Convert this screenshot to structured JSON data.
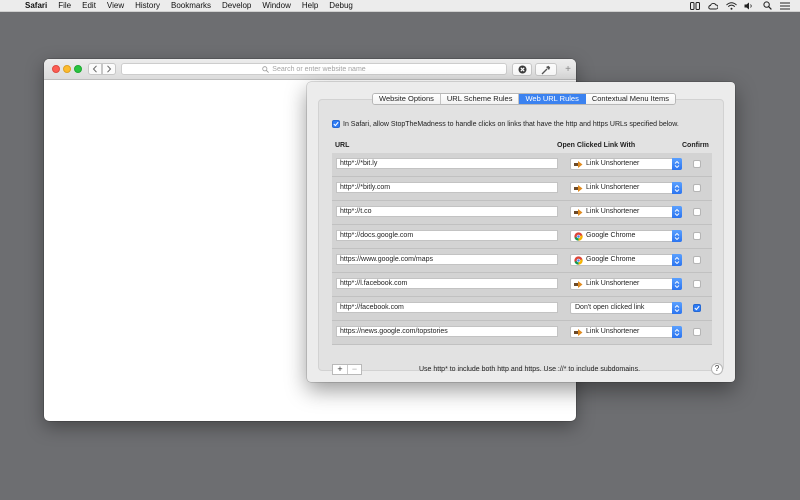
{
  "menubar": {
    "app_name": "Safari",
    "items": [
      "File",
      "Edit",
      "View",
      "History",
      "Bookmarks",
      "Develop",
      "Window",
      "Help",
      "Debug"
    ]
  },
  "safari": {
    "address_placeholder": "Search or enter website name"
  },
  "prefs": {
    "tabs": [
      "Website Options",
      "URL Scheme Rules",
      "Web URL Rules",
      "Contextual Menu Items"
    ],
    "active_tab": "Web URL Rules",
    "allow_text": "In Safari, allow StopTheMadness to handle clicks on links that have the http and https URLs specified below.",
    "allow_checked": true,
    "columns": {
      "url": "URL",
      "open_with": "Open Clicked Link With",
      "confirm": "Confirm"
    },
    "rows": [
      {
        "url": "http*://*bit.ly",
        "app": "Link Unshortener",
        "icon": "arrow-icon",
        "confirm": false
      },
      {
        "url": "http*://*bitly.com",
        "app": "Link Unshortener",
        "icon": "arrow-icon",
        "confirm": false
      },
      {
        "url": "http*://t.co",
        "app": "Link Unshortener",
        "icon": "arrow-icon",
        "confirm": false
      },
      {
        "url": "http*://docs.google.com",
        "app": "Google Chrome",
        "icon": "chrome-icon",
        "confirm": false
      },
      {
        "url": "https://www.google.com/maps",
        "app": "Google Chrome",
        "icon": "chrome-icon",
        "confirm": false
      },
      {
        "url": "http*://l.facebook.com",
        "app": "Link Unshortener",
        "icon": "arrow-icon",
        "confirm": false
      },
      {
        "url": "http*://facebook.com",
        "app": "Don't open clicked link",
        "icon": "",
        "confirm": true
      },
      {
        "url": "https://news.google.com/topstories",
        "app": "Link Unshortener",
        "icon": "arrow-icon",
        "confirm": false
      }
    ],
    "add_label": "+",
    "remove_label": "−",
    "hint": "Use http* to include both http and https. Use ://* to include subdomains.",
    "help_label": "?"
  },
  "colors": {
    "accent": "#3b82f0",
    "desktop": "#6d6e71"
  }
}
